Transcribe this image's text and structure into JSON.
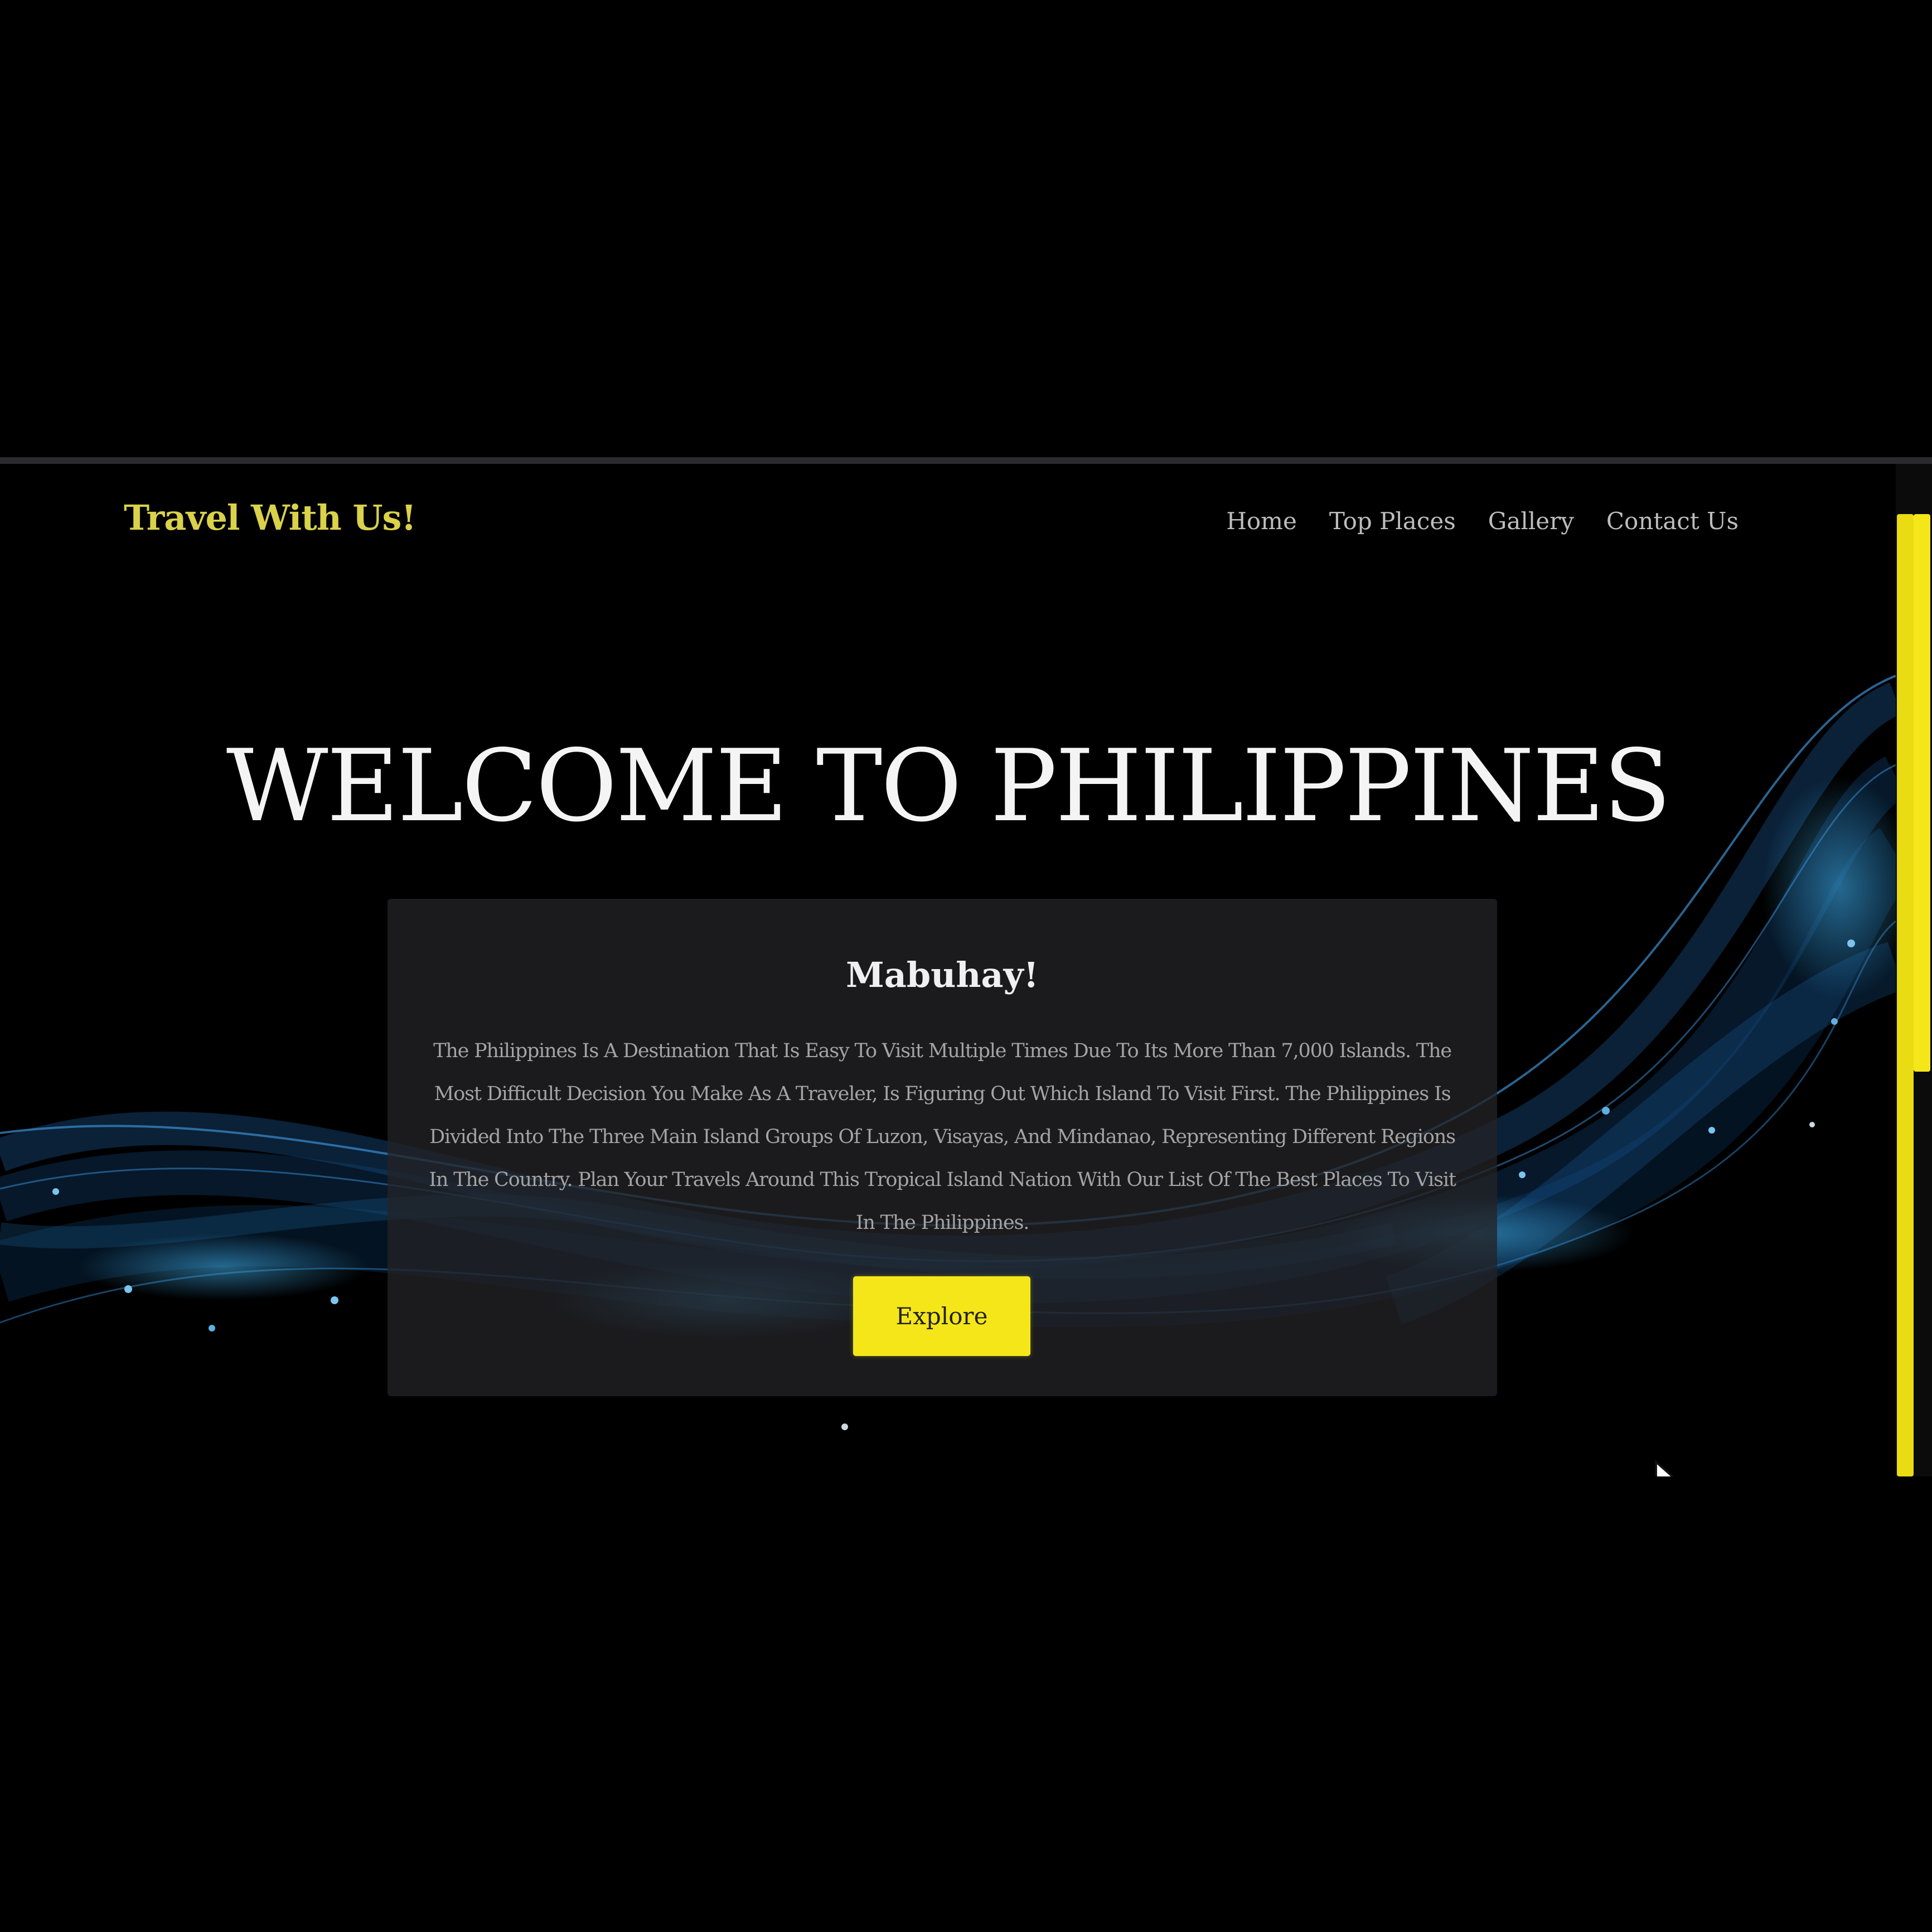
{
  "navbar": {
    "logo": "Travel With Us!",
    "links": [
      "Home",
      "Top Places",
      "Gallery",
      "Contact Us"
    ]
  },
  "hero": {
    "title": "WELCOME TO PHILIPPINES"
  },
  "card": {
    "title": "Mabuhay!",
    "text": "The Philippines Is A Destination That Is Easy To Visit Multiple Times Due To Its More Than 7,000 Islands. The Most Difficult Decision You Make As A Traveler, Is Figuring Out Which Island To Visit First. The Philippines Is Divided Into The Three Main Island Groups Of Luzon, Visayas, And Mindanao, Representing Different Regions In The Country. Plan Your Travels Around This Tropical Island Nation With Our List Of The Best Places To Visit In The Philippines.",
    "button_label": "Explore"
  },
  "colors": {
    "accent": "#f5e61a",
    "logo": "#d9d24a",
    "background": "#000000"
  },
  "icons": {
    "cursor": "mouse-pointer-icon"
  }
}
